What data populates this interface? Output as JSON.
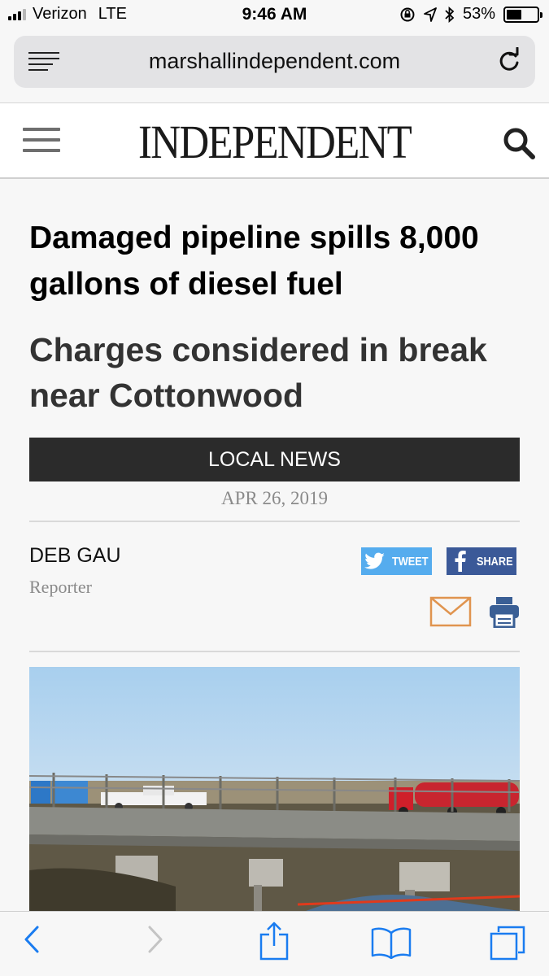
{
  "status_bar": {
    "carrier": "Verizon",
    "network": "LTE",
    "time": "9:46 AM",
    "battery": "53%",
    "battery_level": 0.53
  },
  "browser": {
    "url": "marshallindependent.com"
  },
  "site": {
    "logo_text": "INDEPENDENT"
  },
  "article": {
    "headline": "Damaged pipeline spills 8,000 gallons of diesel fuel",
    "subheadline": "Charges considered in break near Cottonwood",
    "category": "LOCAL NEWS",
    "date": "APR 26, 2019",
    "author_name": "DEB GAU",
    "author_role": "Reporter"
  },
  "share": {
    "tweet_label": "TWEET",
    "share_label": "SHARE"
  },
  "colors": {
    "twitter": "#55acee",
    "facebook": "#3b5998",
    "mail_icon": "#e0944f",
    "print_icon": "#3a5f95",
    "category_bar": "#2b2b2b",
    "safari_blue": "#1a7cf0"
  },
  "icons": {
    "browser_menu": "reader-lines-icon",
    "reload": "reload-icon",
    "site_menu": "hamburger-icon",
    "search": "search-icon",
    "email": "mail-icon",
    "print": "print-icon",
    "back": "chevron-left-icon",
    "forward": "chevron-right-icon",
    "share": "share-icon",
    "bookmarks": "book-icon",
    "tabs": "tabs-icon"
  }
}
